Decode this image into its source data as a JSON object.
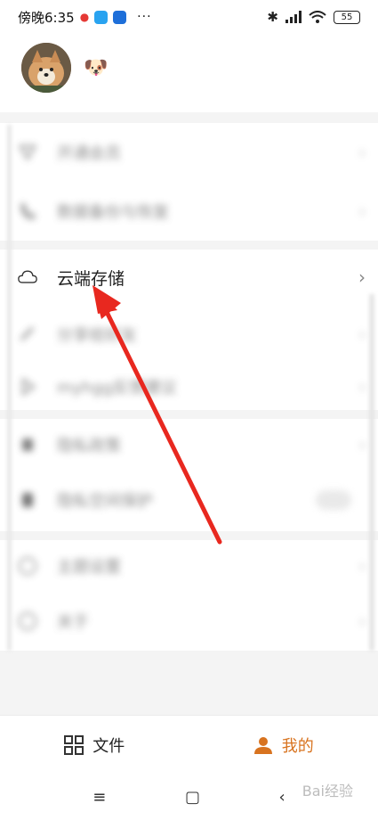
{
  "status_bar": {
    "time": "傍晚6:35",
    "more": "···",
    "battery": "55"
  },
  "profile": {
    "emoji": "🐶"
  },
  "menu": {
    "group1": [
      {
        "label": "开通会员",
        "icon": "vip-icon"
      },
      {
        "label": "数据备份与恢复",
        "icon": "phone-icon"
      }
    ],
    "group2": [
      {
        "label": "云端存储",
        "icon": "cloud-icon"
      },
      {
        "label": "分享给好友",
        "icon": "link-icon"
      },
      {
        "label": "myhgg反馈建议",
        "icon": "play-icon"
      }
    ],
    "group3": [
      {
        "label": "隐私政策",
        "icon": "lock-icon"
      },
      {
        "label": "隐私空间保护",
        "icon": "shield-icon"
      }
    ],
    "group4": [
      {
        "label": "主题设置",
        "icon": "theme-icon"
      },
      {
        "label": "关于",
        "icon": "info-icon"
      }
    ]
  },
  "bottom_nav": {
    "files_label": "文件",
    "mine_label": "我的",
    "active_color": "#d8731f"
  },
  "system_nav": {
    "menu": "≡",
    "home": "▢",
    "back": "‹"
  },
  "watermark": "Bai经验"
}
